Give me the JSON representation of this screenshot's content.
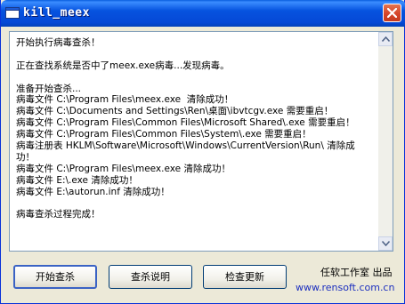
{
  "window": {
    "title": "kill_meex"
  },
  "log": {
    "lines": [
      "开始执行病毒查杀！",
      "",
      "正在查找系统是否中了meex.exe病毒...发现病毒。",
      "",
      "准备开始查杀...",
      "病毒文件 C:\\Program Files\\meex.exe  清除成功！",
      "病毒文件 C:\\Documents and Settings\\Ren\\桌面\\ibvtcgv.exe 需要重启！",
      "病毒文件 C:\\Program Files\\Common Files\\Microsoft Shared\\.exe 需要重启！",
      "病毒文件 C:\\Program Files\\Common Files\\System\\.exe 需要重启！",
      "病毒注册表 HKLM\\Software\\Microsoft\\Windows\\CurrentVersion\\Run\\ 清除成",
      "功！",
      "病毒文件 C:\\Program Files\\meex.exe 清除成功！",
      "病毒文件 E:\\.exe 清除成功！",
      "病毒文件 E:\\autorun.inf 清除成功！",
      "",
      "病毒查杀过程完成！"
    ]
  },
  "buttons": {
    "start": "开始查杀",
    "help": "查杀说明",
    "update": "检查更新"
  },
  "footer": {
    "credit": "任软工作室 出品",
    "website": "www.rensoft.com.cn"
  },
  "icons": {
    "app": "window-icon",
    "close": "close-icon",
    "scroll_up": "arrow-up-icon",
    "scroll_down": "arrow-down-icon"
  },
  "colors": {
    "titlebar": "#0653df",
    "close": "#d5452a",
    "link": "#1c2fbf"
  }
}
